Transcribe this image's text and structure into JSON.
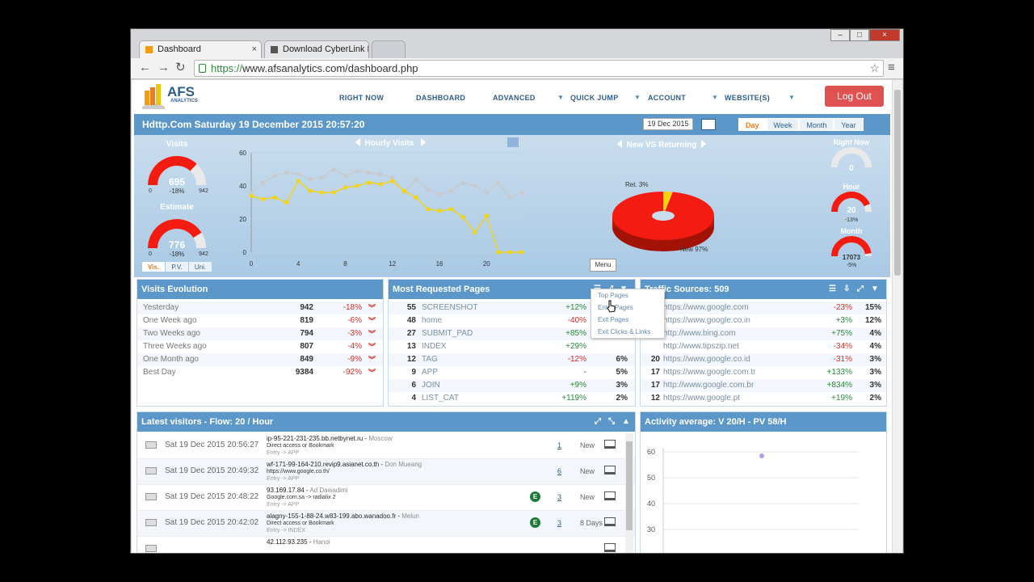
{
  "browser": {
    "tabs": [
      {
        "title": "Dashboard",
        "active": true
      },
      {
        "title": "Download CyberLink Pow",
        "active": false
      }
    ],
    "url_scheme": "https://",
    "url_rest": "www.afsanalytics.com/dashboard.php",
    "close_tab": "×",
    "win_min": "–",
    "win_max": "□",
    "win_close": "×",
    "back": "←",
    "forward": "→",
    "reload": "↻",
    "star": "☆",
    "menu": "≡"
  },
  "logo": {
    "main": "AFS",
    "sub": "ANALYTICS"
  },
  "nav": {
    "items": [
      "RIGHT NOW",
      "DASHBOARD",
      "ADVANCED",
      "QUICK JUMP",
      "ACCOUNT",
      "WEBSITE(S)"
    ],
    "logout": "Log Out"
  },
  "header": {
    "title": "Hdttp.Com Saturday 19 December 2015 20:57:20",
    "date_value": "19 Dec 2015",
    "periods": [
      "Day",
      "Week",
      "Month",
      "Year"
    ],
    "active_period": "Day"
  },
  "hero": {
    "gauges": {
      "visits": {
        "label": "Visits",
        "value": "695",
        "delta": "-18%",
        "min": "0",
        "max": "942",
        "fraction": 0.74
      },
      "estimate": {
        "label": "Estimate",
        "value": "776",
        "delta": "-18%",
        "min": "0",
        "max": "942",
        "fraction": 0.82
      },
      "right_now": {
        "label": "Right Now",
        "value": "0",
        "fraction": 0.0
      },
      "hour": {
        "label": "Hour",
        "value": "20",
        "delta": "-13%",
        "fraction": 0.87
      },
      "month": {
        "label": "Month",
        "value": "17073",
        "delta": "-5%",
        "fraction": 0.95
      }
    },
    "gauge_tabs": [
      "Vis.",
      "P.V.",
      "Uni."
    ],
    "hourly_title": "Hourly Visits",
    "pie_title": "New VS Returning",
    "pie_labels": {
      "returning": "Ret. 3%",
      "new": "New 97%"
    },
    "colors": {
      "red": "#f41c10",
      "yellow": "#f4d40c",
      "grey": "#c9c9c9",
      "header": "#5b97c9"
    }
  },
  "chart_data": [
    {
      "type": "line",
      "title": "Hourly Visits",
      "x": [
        0,
        1,
        2,
        3,
        4,
        5,
        6,
        7,
        8,
        9,
        10,
        11,
        12,
        13,
        14,
        15,
        16,
        17,
        18,
        19,
        20,
        21,
        22,
        23
      ],
      "xticks": [
        0,
        4,
        8,
        12,
        16,
        20
      ],
      "yticks": [
        0,
        20,
        40,
        60
      ],
      "ylim": [
        0,
        60
      ],
      "series": [
        {
          "values": [
            36,
            42,
            46,
            48,
            47,
            44,
            45,
            50,
            46,
            49,
            48,
            47,
            45,
            36,
            44,
            38,
            35,
            37,
            42,
            40,
            36,
            42,
            33,
            36
          ]
        },
        {
          "values": [
            34,
            32,
            33,
            30,
            43,
            37,
            36,
            36,
            39,
            40,
            42,
            41,
            43,
            37,
            33,
            26,
            25,
            26,
            21,
            12,
            22,
            0,
            0,
            0
          ]
        }
      ]
    },
    {
      "type": "pie",
      "title": "New VS Returning",
      "labels": [
        "Ret.",
        "New"
      ],
      "values": [
        3,
        97
      ]
    }
  ],
  "visits_evolution": {
    "title": "Visits Evolution",
    "rows": [
      {
        "label": "Yesterday",
        "value": "942",
        "delta": "-18%"
      },
      {
        "label": "One Week ago",
        "value": "819",
        "delta": "-6%"
      },
      {
        "label": "Two Weeks ago",
        "value": "794",
        "delta": "-3%"
      },
      {
        "label": "Three Weeks ago",
        "value": "807",
        "delta": "-4%"
      },
      {
        "label": "One Month ago",
        "value": "849",
        "delta": "-9%"
      },
      {
        "label": "Best Day",
        "value": "9384",
        "delta": "-92%"
      }
    ]
  },
  "requested_pages": {
    "title": "Most Requested Pages",
    "rows": [
      {
        "count": "55",
        "name": "SCREENSHOT",
        "delta": "+12%",
        "share": ""
      },
      {
        "count": "48",
        "name": "home",
        "delta": "-40%",
        "share": ""
      },
      {
        "count": "27",
        "name": "SUBMIT_PAD",
        "delta": "+85%",
        "share": ""
      },
      {
        "count": "13",
        "name": "INDEX",
        "delta": "+29%",
        "share": ""
      },
      {
        "count": "12",
        "name": "TAG",
        "delta": "-12%",
        "share": "6%"
      },
      {
        "count": "9",
        "name": "APP",
        "delta": "-",
        "share": "5%"
      },
      {
        "count": "6",
        "name": "JOIN",
        "delta": "+9%",
        "share": "3%"
      },
      {
        "count": "4",
        "name": "LIST_CAT",
        "delta": "+119%",
        "share": "2%"
      }
    ],
    "menu_tooltip": "Menu",
    "menu": [
      "Top Pages",
      "Entry Pages",
      "Exit Pages",
      "Exit Clicks & Links"
    ]
  },
  "traffic_sources": {
    "title": "Traffic Sources: 509",
    "rows": [
      {
        "count": "",
        "url": "https://www.google.com",
        "delta": "-23%",
        "share": "15%"
      },
      {
        "count": "",
        "url": "https://www.google.co.in",
        "delta": "+3%",
        "share": "12%"
      },
      {
        "count": "",
        "url": "http://www.bing.com",
        "delta": "+75%",
        "share": "4%"
      },
      {
        "count": "",
        "url": "http://www.tipszip.net",
        "delta": "-34%",
        "share": "4%"
      },
      {
        "count": "20",
        "url": "https://www.google.co.id",
        "delta": "-31%",
        "share": "3%"
      },
      {
        "count": "17",
        "url": "https://www.google.com.tr",
        "delta": "+133%",
        "share": "3%"
      },
      {
        "count": "17",
        "url": "http://www.google.com.br",
        "delta": "+834%",
        "share": "3%"
      },
      {
        "count": "12",
        "url": "https://www.google.pt",
        "delta": "+19%",
        "share": "2%"
      }
    ]
  },
  "latest_visitors": {
    "title": "Latest visitors - Flow: 20 / Hour",
    "rows": [
      {
        "date": "Sat 19 Dec 2015 20:56:27",
        "host": "ip-95-221-231-235.bb.netbynet.ru",
        "city": "Moscow",
        "ref": "Direct access or Bookmark",
        "entry": "Entry -> APP",
        "e": "",
        "count": "1",
        "status": "New"
      },
      {
        "date": "Sat 19 Dec 2015 20:49:32",
        "host": "wf-171-99-164-210.revip9.asianet.co.th",
        "city": "Don Mueang",
        "ref": "https://www.google.co.th/",
        "entry": "Entry -> APP",
        "e": "",
        "count": "6",
        "status": "New"
      },
      {
        "date": "Sat 19 Dec 2015 20:48:22",
        "host": "93.169.17.84",
        "city": "Ad Dawadimi",
        "ref": "Google.com.sa -> radialix 2",
        "entry": "Entry -> APP",
        "e": "E",
        "count": "3",
        "status": "New"
      },
      {
        "date": "Sat 19 Dec 2015 20:42:02",
        "host": "alagny-155-1-88-24.w83-199.abo.wanadoo.fr",
        "city": "Melun",
        "ref": "Direct access or Bookmark",
        "entry": "Entry -> INDEX",
        "e": "E",
        "count": "3",
        "status": "8 Days"
      },
      {
        "date": "",
        "host": "42.112.93.235",
        "city": "Hanoi",
        "ref": "",
        "entry": "",
        "e": "",
        "count": "",
        "status": ""
      }
    ]
  },
  "activity": {
    "title": "Activity average: V 20/H - PV 58/H",
    "yticks": [
      "60",
      "50",
      "40",
      "30"
    ]
  }
}
